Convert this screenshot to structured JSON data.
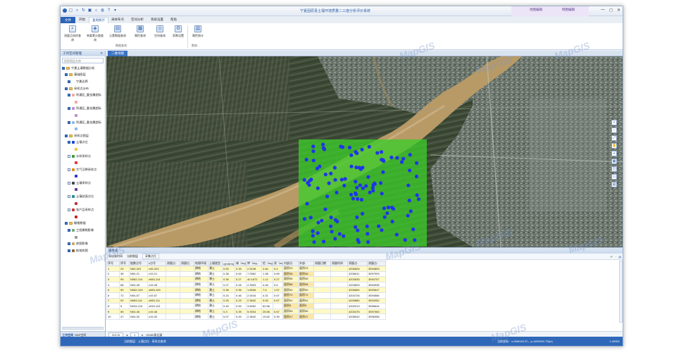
{
  "app": {
    "title": "宁夏固原县土壤环境质量二三度分析评价系统",
    "context_header_left": "地图编辑",
    "context_header_right": "制图编辑",
    "context_tabs": [
      "点编辑",
      "线编辑",
      "区编辑",
      "数据编辑"
    ],
    "window_controls": [
      "—",
      "◻",
      "✕"
    ]
  },
  "ribbon": {
    "file_tab": "文件",
    "tabs": [
      "开始",
      "查询统计",
      "采样布点",
      "空间分析",
      "系统设置",
      "帮助"
    ],
    "active_tab_index": 1,
    "buttons": [
      {
        "label": "测量点采样查询",
        "icon": "query-icon"
      },
      {
        "label": "单要素分量查询",
        "icon": "element-icon"
      },
      {
        "label": "元素数据查询",
        "icon": "data-icon"
      },
      {
        "label": "属性查询",
        "icon": "attribute-icon"
      },
      {
        "label": "空间查询",
        "icon": "spatial-icon"
      },
      {
        "label": "家数设置",
        "icon": "settings-icon"
      },
      {
        "label": "属性统计",
        "icon": "stats-icon"
      }
    ],
    "groups": [
      "数据查询",
      "数统..."
    ]
  },
  "left_panel": {
    "title": "工作空间管理",
    "search_placeholder": "搜索图层名称",
    "tree": [
      {
        "label": "宁夏土壤数据分析",
        "level": 0,
        "checked": true,
        "kind": "folder"
      },
      {
        "label": "基础图层",
        "level": 1,
        "checked": true,
        "kind": "folder"
      },
      {
        "label": "宁夏边界",
        "level": 2,
        "checked": true,
        "kind": "layer",
        "color": "#ffffff"
      },
      {
        "label": "采样点分布",
        "level": 1,
        "checked": true,
        "kind": "folder"
      },
      {
        "label": "利通区_重金属超标",
        "level": 2,
        "checked": true,
        "kind": "layer",
        "color": "#f4a6a6"
      },
      {
        "label": "",
        "level": 3,
        "checked": false,
        "kind": "swatch",
        "color": "#f4a6a6"
      },
      {
        "label": "利通区_重金属超标",
        "level": 2,
        "checked": true,
        "kind": "layer",
        "color": "#c38bd0"
      },
      {
        "label": "",
        "level": 3,
        "checked": false,
        "kind": "swatch",
        "color": "#c38bd0"
      },
      {
        "label": "利通区_重金属超标",
        "level": 2,
        "checked": true,
        "kind": "layer",
        "color": "#8fb8e8"
      },
      {
        "label": "",
        "level": 3,
        "checked": false,
        "kind": "swatch",
        "color": "#8fb8e8"
      },
      {
        "label": "采样点图层",
        "level": 1,
        "checked": true,
        "kind": "folder"
      },
      {
        "label": "土壤点位",
        "level": 2,
        "checked": true,
        "kind": "layer",
        "color": "#1d3fe0"
      },
      {
        "label": "",
        "level": 3,
        "checked": false,
        "kind": "swatch",
        "color": "#f0c040"
      },
      {
        "label": "水样采样点",
        "level": 2,
        "checked": false,
        "kind": "layer",
        "color": "#3a9b3a"
      },
      {
        "label": "",
        "level": 3,
        "checked": false,
        "kind": "swatch",
        "color": "#e33"
      },
      {
        "label": "大气沉降采样点",
        "level": 2,
        "checked": false,
        "kind": "layer",
        "color": "#e38a1a"
      },
      {
        "label": "",
        "level": 3,
        "checked": false,
        "kind": "swatch",
        "color": "#33c"
      },
      {
        "label": "土壤采样点",
        "level": 2,
        "checked": false,
        "kind": "layer",
        "color": "#444"
      },
      {
        "label": "",
        "level": 3,
        "checked": false,
        "kind": "swatch",
        "color": "#6a3a9b"
      },
      {
        "label": "土壤剖面点位",
        "level": 2,
        "checked": false,
        "kind": "layer",
        "color": "#2a8a8a"
      },
      {
        "label": "",
        "level": 3,
        "checked": false,
        "kind": "swatch",
        "color": "#b33"
      },
      {
        "label": "农产品采样点",
        "level": 2,
        "checked": false,
        "kind": "layer",
        "color": "#c83a3a"
      },
      {
        "label": "",
        "level": 3,
        "checked": false,
        "kind": "swatch",
        "color": "#c22"
      },
      {
        "label": "栅格数据",
        "level": 1,
        "checked": true,
        "kind": "folder"
      },
      {
        "label": "工程栅格影像",
        "level": 2,
        "checked": true,
        "kind": "layer",
        "color": "#7a7"
      },
      {
        "label": "",
        "level": 3,
        "checked": false,
        "kind": "swatch",
        "color": "#999"
      },
      {
        "label": "底图影像",
        "level": 2,
        "checked": true,
        "kind": "layer",
        "color": "#c9a86a"
      },
      {
        "label": "航拍底图",
        "level": 2,
        "checked": true,
        "kind": "layer",
        "color": "#8a6a3a"
      }
    ],
    "bottom_tabs": [
      "工作空间",
      "SDE空间"
    ]
  },
  "map": {
    "doc_tab": "二维地图",
    "tools": [
      "+",
      "−",
      "⤢",
      "✋",
      "⌖",
      "▦",
      "◫",
      "▭",
      "▤"
    ]
  },
  "attr_table": {
    "title": "属性表",
    "toolbar": [
      "导出该时间",
      "当前图层"
    ],
    "toolbar_tab": "采集点位",
    "columns": [
      "序号",
      "序号",
      "链数点号",
      "z点号",
      "测量点..",
      "测量位..",
      "地理环境",
      "土壤类型",
      "v(mS/m)",
      "锡（mg..",
      "钾（mg..",
      "铝（mg..",
      "汞（mg..",
      "内部点..",
      "外部..",
      "测量日期",
      "测量时间",
      "测量点..",
      "测量点.."
    ],
    "rows": [
      [
        "1",
        "23",
        "N63-322",
        "z45-323",
        "",
        "",
        "耕地",
        "潮土",
        "0.53",
        "0.35",
        "2.5108",
        "2.84",
        "0.4",
        "面积23",
        "面积23",
        "",
        "",
        "4206826",
        "3594853"
      ],
      [
        "2",
        "36",
        "N54-21",
        "z19-21",
        "",
        "",
        "耕地",
        "潮土",
        "0.38",
        "0.63",
        "7.0962",
        "1.38",
        "0.69",
        "面积36",
        "面积36",
        "",
        "",
        "4206611",
        "3597993"
      ],
      [
        "3",
        "95",
        "N082-114",
        "z083-114",
        "",
        "",
        "耕地",
        "潮土",
        "0.35",
        "0.27",
        "40.1672",
        "1.12",
        "0.27",
        "面积95",
        "面积95",
        "",
        "",
        "4203535",
        "3594757"
      ],
      [
        "4",
        "68",
        "N04-45",
        "z19-45",
        "",
        "",
        "耕地",
        "潮土",
        "0.27",
        "0.28",
        "2.3903",
        "4.46",
        "0.6",
        "面积68",
        "面积68",
        "",
        "",
        "4203825",
        "3594935"
      ],
      [
        "5",
        "90",
        "N082-109",
        "z083-109",
        "",
        "",
        "耕地",
        "潮土",
        "0.38",
        "0.36",
        "1.6546",
        "7.6",
        "1.57",
        "面积90",
        "面积90",
        "",
        "",
        "4206854",
        "3593647"
      ],
      [
        "6",
        "72",
        "N04-57",
        "z19-57",
        "",
        "",
        "耕地",
        "潮土",
        "0.24",
        "0.46",
        "2.9244",
        "4.31",
        "0.67",
        "面积72",
        "面积72",
        "",
        "",
        "4204726",
        "3594566"
      ],
      [
        "7",
        "92",
        "N083-111",
        "z083-111",
        "",
        "",
        "耕地",
        "潮土",
        "0.25",
        "0.23",
        "2.3642",
        "0.63",
        "0.67",
        "面积92",
        "面积92",
        "",
        "",
        "4205880",
        "3593352"
      ],
      [
        "8",
        "5",
        "N034-113",
        "z034-113",
        "",
        "",
        "耕地",
        "潮土",
        "0.40",
        "0.59",
        "3.8262",
        "62.86",
        "",
        "面积5",
        "面积5",
        "",
        "",
        "4202013",
        "3596644"
      ],
      [
        "9",
        "55",
        "N04-46",
        "z19-46",
        "",
        "",
        "耕地",
        "潮土",
        "0.3",
        "0.39",
        "5.9204",
        "25.56",
        "0.67",
        "面积55",
        "面积55",
        "",
        "",
        "4203475",
        "3597083"
      ],
      [
        "10",
        "47",
        "N04-32",
        "z19-32",
        "",
        "",
        "耕地",
        "潮土",
        "0.07",
        "0.49",
        "2.3642",
        "10.62",
        "0.39",
        "面积47",
        "面积47",
        "",
        "",
        "4208042",
        "3596058"
      ]
    ],
    "pager": {
      "total_label": "20176",
      "page": "1",
      "of_label": "20160条记录"
    }
  },
  "status_bar": {
    "left": "当前图层：土壤点位 · 采样点查询",
    "coords": "当前坐标：x=598128.37，y=4209910.75(m)",
    "scale": "1:40901"
  },
  "watermark": "MapGIS",
  "colors": {
    "accent": "#2f68b9",
    "selection_fill": "#3ccc2a",
    "point_color": "#1f35e8"
  }
}
